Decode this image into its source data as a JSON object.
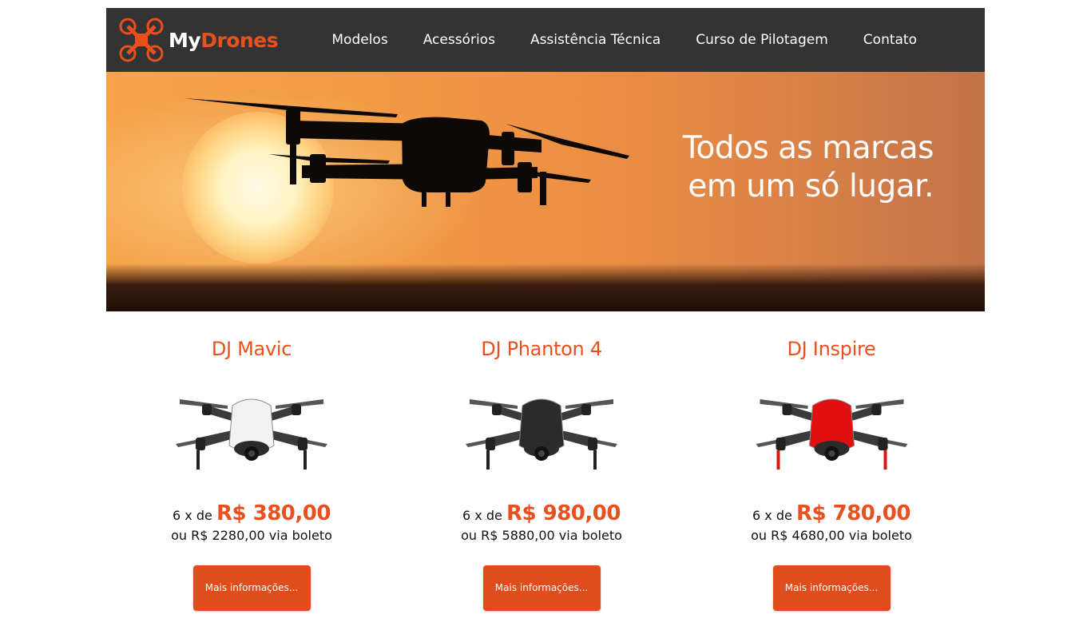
{
  "brand": {
    "logo_my": "My",
    "logo_drones": "Drones",
    "accent": "#e8501f"
  },
  "nav": {
    "items": [
      {
        "label": "Modelos"
      },
      {
        "label": "Acessórios"
      },
      {
        "label": "Assistência Técnica"
      },
      {
        "label": "Curso de Pilotagem"
      },
      {
        "label": "Contato"
      }
    ]
  },
  "hero": {
    "line1": "Todos as marcas",
    "line2": "em um só lugar."
  },
  "products": [
    {
      "name": "DJ Mavic",
      "installments": "6 x de",
      "price": "R$ 380,00",
      "boleto": "ou R$ 2280,00 via boleto",
      "button": "Mais informações...",
      "body_color": "#f2f2f2"
    },
    {
      "name": "DJ Phanton 4",
      "installments": "6 x de",
      "price": "R$ 980,00",
      "boleto": "ou R$ 5880,00 via boleto",
      "button": "Mais informações...",
      "body_color": "#2b2b2b"
    },
    {
      "name": "DJ Inspire",
      "installments": "6 x de",
      "price": "R$ 780,00",
      "boleto": "ou R$ 4680,00 via boleto",
      "button": "Mais informações...",
      "body_color": "#e01010"
    }
  ]
}
